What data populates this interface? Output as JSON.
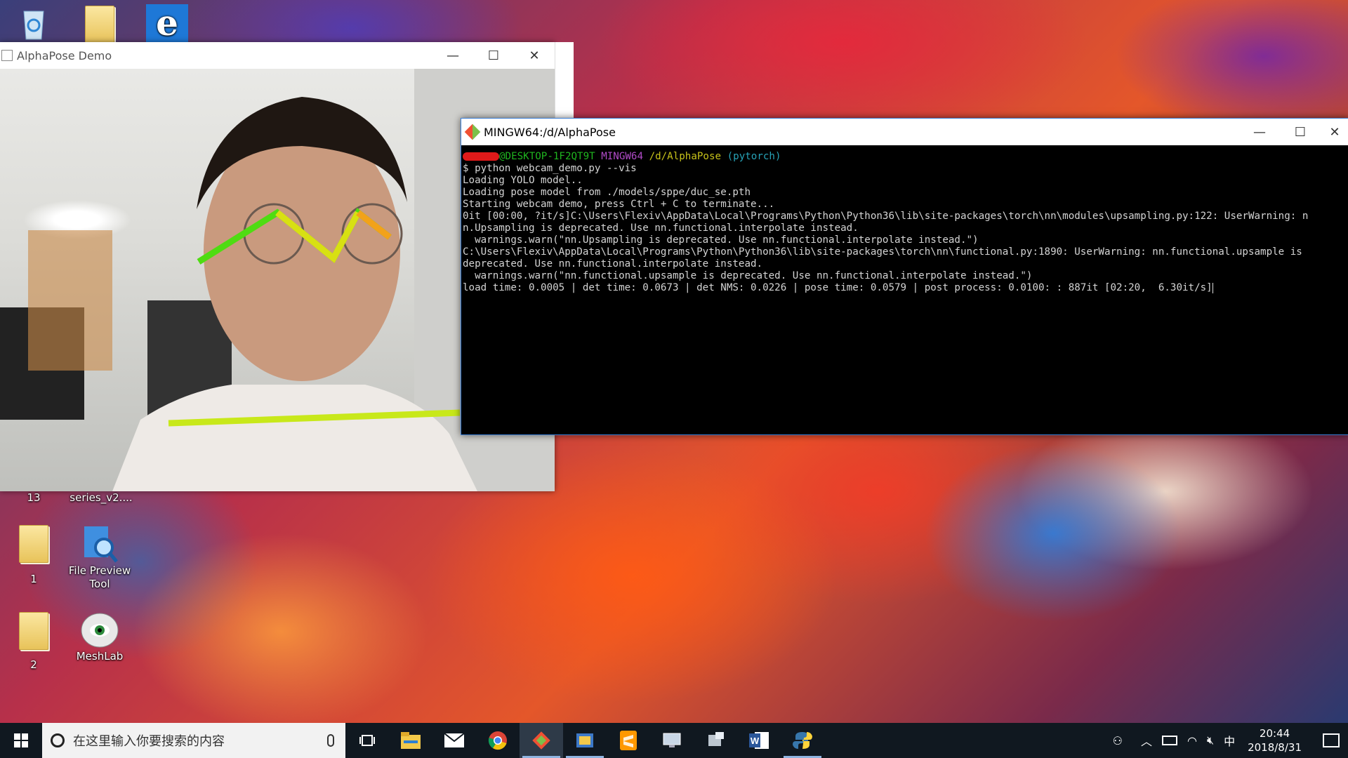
{
  "desktop": {
    "icons": [
      {
        "label": "",
        "icon": "recycle-bin-icon"
      },
      {
        "label": "",
        "icon": "folder-icon"
      },
      {
        "label": "",
        "icon": "edge-icon"
      },
      {
        "label": "13",
        "icon": "folder-icon"
      },
      {
        "label": "series_v2....",
        "icon": "folder-icon"
      },
      {
        "label": "1",
        "icon": "folder-icon"
      },
      {
        "label": "File Preview Tool",
        "icon": "file-preview-tool-icon"
      },
      {
        "label": "2",
        "icon": "folder-icon"
      },
      {
        "label": "MeshLab",
        "icon": "meshlab-icon"
      }
    ]
  },
  "alphapose_window": {
    "title": "AlphaPose Demo",
    "minimize": "—",
    "maximize": "☐",
    "close": "✕"
  },
  "terminal_window": {
    "title": "MINGW64:/d/AlphaPose",
    "minimize": "—",
    "maximize": "☐",
    "close": "✕",
    "prompt": {
      "user": "@DESKTOP-1F2QT9T",
      "shell": "MINGW64",
      "path": "/d/AlphaPose",
      "env": "(pytorch)"
    },
    "lines": [
      "$ python webcam_demo.py --vis",
      "Loading YOLO model..",
      "Loading pose model from ./models/sppe/duc_se.pth",
      "Starting webcam demo, press Ctrl + C to terminate...",
      "0it [00:00, ?it/s]C:\\Users\\Flexiv\\AppData\\Local\\Programs\\Python\\Python36\\lib\\site-packages\\torch\\nn\\modules\\upsampling.py:122: UserWarning: n",
      "n.Upsampling is deprecated. Use nn.functional.interpolate instead.",
      "  warnings.warn(\"nn.Upsampling is deprecated. Use nn.functional.interpolate instead.\")",
      "C:\\Users\\Flexiv\\AppData\\Local\\Programs\\Python\\Python36\\lib\\site-packages\\torch\\nn\\functional.py:1890: UserWarning: nn.functional.upsample is",
      "deprecated. Use nn.functional.interpolate instead.",
      "  warnings.warn(\"nn.functional.upsample is deprecated. Use nn.functional.interpolate instead.\")",
      "load time: 0.0005 | det time: 0.0673 | det NMS: 0.0226 | pose time: 0.0579 | post process: 0.0100: : 887it [02:20,  6.30it/s]"
    ]
  },
  "taskbar": {
    "search_placeholder": "在这里输入你要搜索的内容",
    "apps": [
      {
        "icon": "file-explorer-icon"
      },
      {
        "icon": "mail-icon"
      },
      {
        "icon": "chrome-icon"
      },
      {
        "icon": "git-bash-icon"
      },
      {
        "icon": "python-app-icon"
      },
      {
        "icon": "sublime-text-icon"
      },
      {
        "icon": "remote-desktop-icon"
      },
      {
        "icon": "network-tool-icon"
      },
      {
        "icon": "word-icon"
      },
      {
        "icon": "python-icon"
      }
    ],
    "ime": "中",
    "time": "20:44",
    "date": "2018/8/31"
  },
  "colors": {
    "terminal_user": "#1fb51f",
    "terminal_shell": "#b14bc8",
    "terminal_path": "#c7c21a",
    "terminal_env": "#27a3b8",
    "taskbar_bg": "#101820"
  }
}
